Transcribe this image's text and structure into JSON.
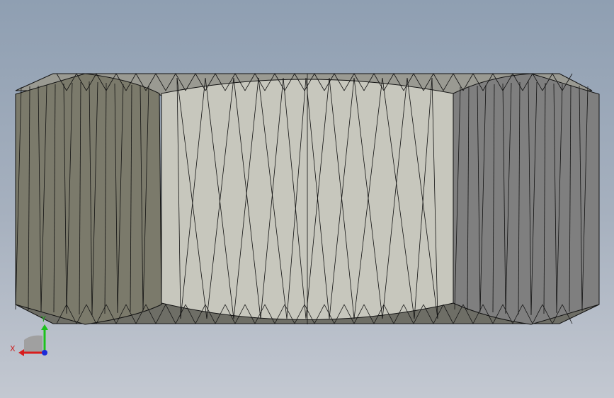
{
  "viewport": {
    "colors": {
      "left_face": "#7b7a6b",
      "middle_face": "#c7c7bd",
      "right_face": "#7f7f7f",
      "top_bevel": "#9a9a92",
      "bottom_bevel": "#6e6e66",
      "edge": "#111111"
    }
  },
  "triad": {
    "x_label": "X",
    "y_label": "Y",
    "x_color": "#d81c1c",
    "y_color": "#1cc21c",
    "z_color": "#1c2bd8"
  }
}
